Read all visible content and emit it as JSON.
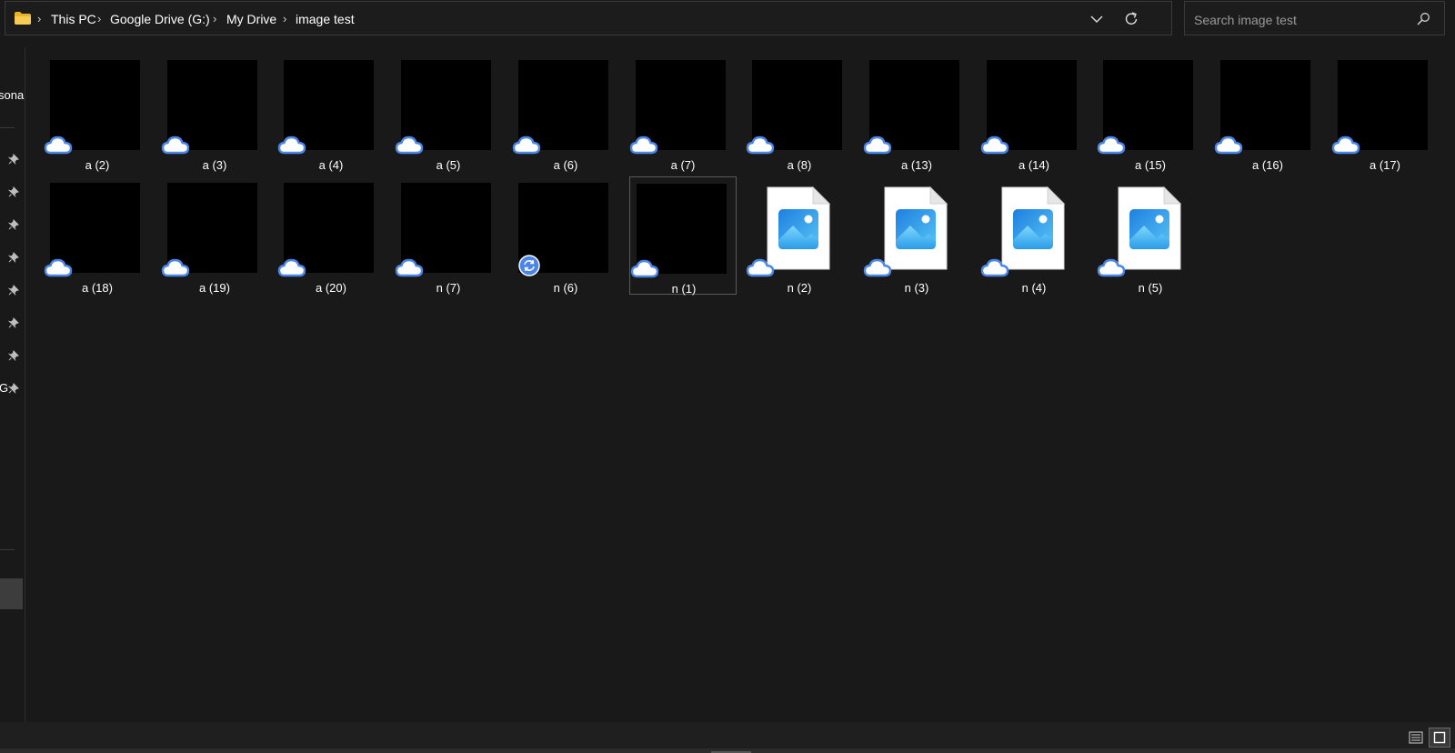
{
  "breadcrumb": {
    "items": [
      "This PC",
      "Google Drive (G:)",
      "My Drive",
      "image test"
    ]
  },
  "search": {
    "placeholder": "Search image test"
  },
  "nav": {
    "labels": [
      "sona",
      "G"
    ]
  },
  "files": [
    {
      "name": "a (2)",
      "type": "thumbnail",
      "status": "cloud"
    },
    {
      "name": "a (3)",
      "type": "thumbnail",
      "status": "cloud"
    },
    {
      "name": "a (4)",
      "type": "thumbnail",
      "status": "cloud"
    },
    {
      "name": "a (5)",
      "type": "thumbnail",
      "status": "cloud"
    },
    {
      "name": "a (6)",
      "type": "thumbnail",
      "status": "cloud"
    },
    {
      "name": "a (7)",
      "type": "thumbnail",
      "status": "cloud"
    },
    {
      "name": "a (8)",
      "type": "thumbnail",
      "status": "cloud"
    },
    {
      "name": "a (13)",
      "type": "thumbnail",
      "status": "cloud"
    },
    {
      "name": "a (14)",
      "type": "thumbnail",
      "status": "cloud"
    },
    {
      "name": "a (15)",
      "type": "thumbnail",
      "status": "cloud"
    },
    {
      "name": "a (16)",
      "type": "thumbnail",
      "status": "cloud"
    },
    {
      "name": "a (17)",
      "type": "thumbnail",
      "status": "cloud"
    },
    {
      "name": "a (18)",
      "type": "thumbnail",
      "status": "cloud"
    },
    {
      "name": "a (19)",
      "type": "thumbnail",
      "status": "cloud"
    },
    {
      "name": "a (20)",
      "type": "thumbnail",
      "status": "cloud"
    },
    {
      "name": "n (7)",
      "type": "thumbnail",
      "status": "cloud"
    },
    {
      "name": "n (6)",
      "type": "thumbnail",
      "status": "syncing"
    },
    {
      "name": "n (1)",
      "type": "thumbnail",
      "status": "cloud",
      "selected": true
    },
    {
      "name": "n (2)",
      "type": "image-file",
      "status": "cloud"
    },
    {
      "name": "n (3)",
      "type": "image-file",
      "status": "cloud"
    },
    {
      "name": "n (4)",
      "type": "image-file",
      "status": "cloud"
    },
    {
      "name": "n (5)",
      "type": "image-file",
      "status": "cloud"
    }
  ],
  "icons": {
    "folder": "folder-icon",
    "chevron": "chevron-right-icon",
    "dropdown": "chevron-down-icon",
    "refresh": "refresh-icon",
    "search": "search-icon",
    "pin": "pin-icon",
    "cloud": "cloud-icon",
    "sync": "sync-icon",
    "details_view": "details-view-icon",
    "large_icons_view": "large-icons-view-icon"
  },
  "colors": {
    "background": "#191919",
    "accent": "#0078d4",
    "cloud_outline": "#4a86e8",
    "folder": "#f4c542"
  }
}
